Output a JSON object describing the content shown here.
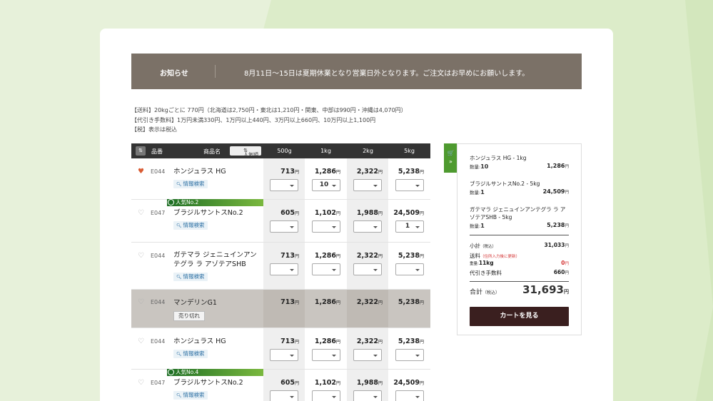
{
  "notice": {
    "label": "お知らせ",
    "message": "8月11日〜15日は夏期休業となり営業日外となります。ご注文はお早めにお願いします。"
  },
  "info": [
    "【送料】20kgごとに 770円（北海道は2,750円・東北は1,210円・関東、中部は990円・沖縄は4,070円）",
    "【代引き手数料】1万円未満330円、1万円以上440円、3万円以上660円、10万円以上1,100円",
    "【税】表示は税込"
  ],
  "table": {
    "sort_icon": "sort-icon",
    "col_code": "品番",
    "col_name": "商品名",
    "popularity_btn": "人気順",
    "sizes": [
      "500g",
      "1kg",
      "2kg",
      "5kg"
    ],
    "search_label": "情報検索",
    "yen": "円",
    "rows": [
      {
        "fav": true,
        "code": "E044",
        "name_lines": [
          "ホンジュラス HG"
        ],
        "badge": "",
        "soldout": false,
        "prices": [
          "713",
          "1,286",
          "2,322",
          "5,238"
        ],
        "qty": [
          "",
          "10",
          "",
          ""
        ]
      },
      {
        "fav": false,
        "code": "E047",
        "name_lines": [
          "ブラジルサントスNo.2"
        ],
        "badge": "人気No.2",
        "soldout": false,
        "prices": [
          "605",
          "1,102",
          "1,988",
          "24,509"
        ],
        "qty": [
          "",
          "",
          "",
          "1"
        ]
      },
      {
        "fav": false,
        "code": "E044",
        "name_lines": [
          "ガテマラ ジェニュインアン",
          "テグラ ラ アゾテアSHB"
        ],
        "badge": "",
        "soldout": false,
        "prices": [
          "713",
          "1,286",
          "2,322",
          "5,238"
        ],
        "qty": [
          "",
          "",
          "",
          ""
        ]
      },
      {
        "fav": false,
        "code": "E044",
        "name_lines": [
          "マンデリンG1"
        ],
        "badge": "",
        "soldout": true,
        "sold_label": "売り切れ",
        "prices": [
          "713",
          "1,286",
          "2,322",
          "5,238"
        ],
        "qty": [
          "",
          "",
          "",
          ""
        ]
      },
      {
        "fav": false,
        "code": "E044",
        "name_lines": [
          "ホンジュラス HG"
        ],
        "badge": "",
        "soldout": false,
        "prices": [
          "713",
          "1,286",
          "2,322",
          "5,238"
        ],
        "qty": [
          "",
          "",
          "",
          ""
        ]
      },
      {
        "fav": false,
        "code": "E047",
        "name_lines": [
          "ブラジルサントスNo.2"
        ],
        "badge": "人気No.4",
        "soldout": false,
        "prices": [
          "605",
          "1,102",
          "1,988",
          "24,509"
        ],
        "qty": [
          "",
          "",
          "",
          ""
        ]
      }
    ]
  },
  "cart": {
    "tab_icons": [
      "cart-icon",
      "double-chevron-right-icon"
    ],
    "items": [
      {
        "name": "ホンジュラス HG - 1kg",
        "qty_label": "数量:",
        "qty": "10",
        "price": "1,286"
      },
      {
        "name": "ブラジルサントスNo.2 - 5kg",
        "qty_label": "数量:",
        "qty": "1",
        "price": "24,509"
      },
      {
        "name": "ガテマラ ジェニュインアンテグラ ラ アゾテアSHB - 5kg",
        "qty_label": "数量:",
        "qty": "1",
        "price": "5,238"
      }
    ],
    "subtotal_label": "小計",
    "tax_in": "（税込）",
    "subtotal": "31,033",
    "shipping_label": "送料",
    "shipping_note": "（住所入力後に更新）",
    "weight_label": "重量:",
    "weight": "11kg",
    "shipping": "0",
    "cod_label": "代引き手数料",
    "cod": "660",
    "total_label": "合計",
    "total": "31,693",
    "yen": "円",
    "button": "カートを見る"
  }
}
